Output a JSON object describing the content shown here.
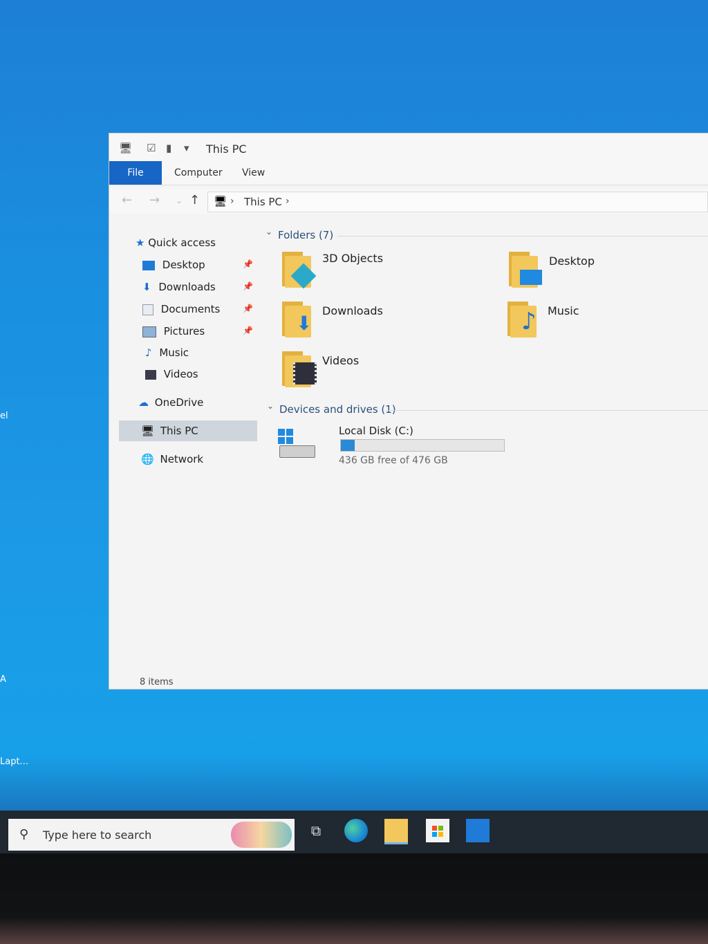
{
  "window": {
    "title": "This PC"
  },
  "ribbon": {
    "tabs": [
      "File",
      "Computer",
      "View"
    ]
  },
  "address": {
    "path": [
      "This PC"
    ]
  },
  "sidebar": {
    "quick_access": "Quick access",
    "items": [
      {
        "label": "Desktop",
        "pinned": true
      },
      {
        "label": "Downloads",
        "pinned": true
      },
      {
        "label": "Documents",
        "pinned": true
      },
      {
        "label": "Pictures",
        "pinned": true
      },
      {
        "label": "Music",
        "pinned": false
      },
      {
        "label": "Videos",
        "pinned": false
      }
    ],
    "onedrive": "OneDrive",
    "this_pc": "This PC",
    "network": "Network"
  },
  "content": {
    "folders_header": "Folders (7)",
    "folders": [
      "3D Objects",
      "Desktop",
      "Downloads",
      "Music",
      "Videos"
    ],
    "devices_header": "Devices and drives (1)",
    "drive": {
      "name": "Local Disk (C:)",
      "free_text": "436 GB free of 476 GB",
      "used_fraction": 0.084
    }
  },
  "status": {
    "items": "8 items"
  },
  "desktop": {
    "partial_labels": [
      "el",
      "A",
      "Lapt..."
    ]
  },
  "taskbar": {
    "search_placeholder": "Type here to search"
  },
  "colors": {
    "accent": "#1765c5",
    "drive_fill": "#2a8ad8",
    "folder": "#f2c75c"
  }
}
